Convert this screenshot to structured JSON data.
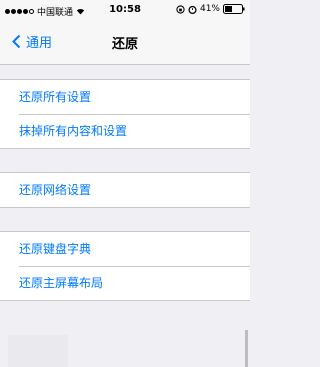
{
  "status_bar": {
    "carrier": "中国联通",
    "time": "10:58",
    "battery": "41%"
  },
  "nav": {
    "back_label": "通用",
    "title": "还原"
  },
  "groups": [
    {
      "items": [
        "还原所有设置",
        "抹掉所有内容和设置"
      ]
    },
    {
      "items": [
        "还原网络设置"
      ]
    },
    {
      "items": [
        "还原键盘字典",
        "还原主屏幕布局"
      ]
    }
  ],
  "colors": {
    "accent": "#007aff",
    "background": "#efeff4"
  }
}
